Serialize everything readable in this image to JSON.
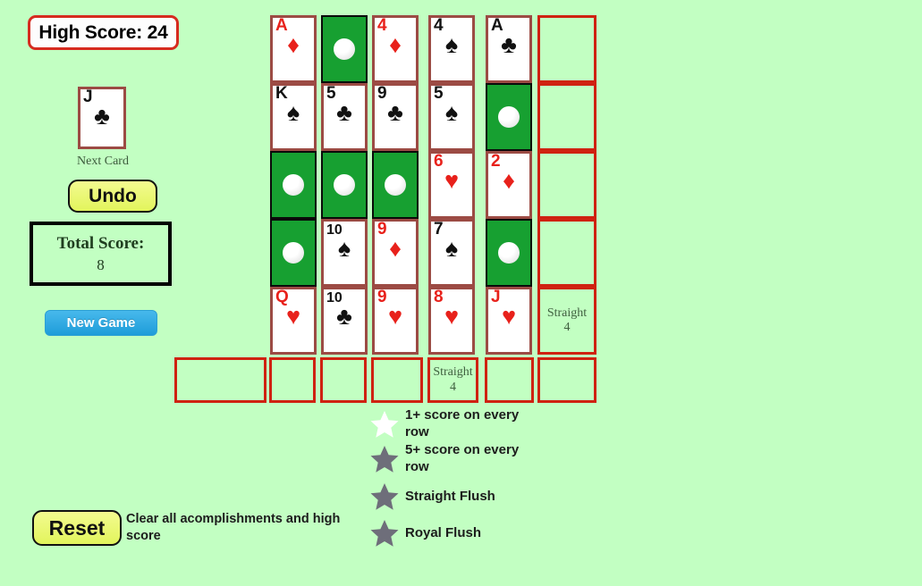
{
  "high_score": {
    "label": "High Score: 24"
  },
  "next_card": {
    "label": "Next Card",
    "rank": "J",
    "suit_glyph": "♣",
    "color": "black"
  },
  "buttons": {
    "undo": "Undo",
    "new_game": "New Game",
    "reset": "Reset"
  },
  "total_score": {
    "title": "Total Score:",
    "value": "8"
  },
  "reset_note": "Clear all acomplishments and high score",
  "colors": {
    "background": "#c2ffc2",
    "card_border": "#9c4b44",
    "card_back_green": "#17a031",
    "score_border_red": "#cf2211",
    "high_score_border": "#d62b1f",
    "red_suit": "#e8211b",
    "black_suit": "#111111",
    "star_earned": "#ffffff",
    "star_locked": "#6e6e7a",
    "new_game_blue": "#1e9cd9",
    "undo_yellow": "#e2f45c"
  },
  "board": {
    "rows": [
      {
        "cells": [
          {
            "type": "card",
            "rank": "A",
            "suit": "♦",
            "color": "red"
          },
          {
            "type": "back"
          },
          {
            "type": "card",
            "rank": "4",
            "suit": "♦",
            "color": "red"
          },
          {
            "type": "card",
            "rank": "4",
            "suit": "♠",
            "color": "black"
          },
          {
            "type": "card",
            "rank": "A",
            "suit": "♣",
            "color": "black"
          }
        ],
        "score": {
          "line1": "",
          "line2": ""
        }
      },
      {
        "cells": [
          {
            "type": "card",
            "rank": "K",
            "suit": "♠",
            "color": "black"
          },
          {
            "type": "card",
            "rank": "5",
            "suit": "♣",
            "color": "black"
          },
          {
            "type": "card",
            "rank": "9",
            "suit": "♣",
            "color": "black"
          },
          {
            "type": "card",
            "rank": "5",
            "suit": "♠",
            "color": "black"
          },
          {
            "type": "back"
          }
        ],
        "score": {
          "line1": "",
          "line2": ""
        }
      },
      {
        "cells": [
          {
            "type": "back"
          },
          {
            "type": "back"
          },
          {
            "type": "back"
          },
          {
            "type": "card",
            "rank": "6",
            "suit": "♥",
            "color": "red"
          },
          {
            "type": "card",
            "rank": "2",
            "suit": "♦",
            "color": "red"
          }
        ],
        "score": {
          "line1": "",
          "line2": ""
        }
      },
      {
        "cells": [
          {
            "type": "back"
          },
          {
            "type": "card",
            "rank": "10",
            "suit": "♠",
            "color": "black"
          },
          {
            "type": "card",
            "rank": "9",
            "suit": "♦",
            "color": "red"
          },
          {
            "type": "card",
            "rank": "7",
            "suit": "♠",
            "color": "black"
          },
          {
            "type": "back"
          }
        ],
        "score": {
          "line1": "",
          "line2": ""
        }
      },
      {
        "cells": [
          {
            "type": "card",
            "rank": "Q",
            "suit": "♥",
            "color": "red"
          },
          {
            "type": "card",
            "rank": "10",
            "suit": "♣",
            "color": "black"
          },
          {
            "type": "card",
            "rank": "9",
            "suit": "♥",
            "color": "red"
          },
          {
            "type": "card",
            "rank": "8",
            "suit": "♥",
            "color": "red"
          },
          {
            "type": "card",
            "rank": "J",
            "suit": "♥",
            "color": "red"
          }
        ],
        "score": {
          "line1": "Straight",
          "line2": "4"
        }
      }
    ],
    "column_scores": [
      {
        "line1": "",
        "line2": ""
      },
      {
        "line1": "",
        "line2": ""
      },
      {
        "line1": "",
        "line2": ""
      },
      {
        "line1": "",
        "line2": ""
      },
      {
        "line1": "Straight",
        "line2": "4"
      },
      {
        "line1": "",
        "line2": ""
      },
      {
        "line1": "",
        "line2": ""
      }
    ]
  },
  "achievements": [
    {
      "label": "1+ score on every row",
      "earned": true
    },
    {
      "label": "5+ score on every row",
      "earned": false
    },
    {
      "label": "Straight Flush",
      "earned": false
    },
    {
      "label": "Royal Flush",
      "earned": false
    }
  ]
}
